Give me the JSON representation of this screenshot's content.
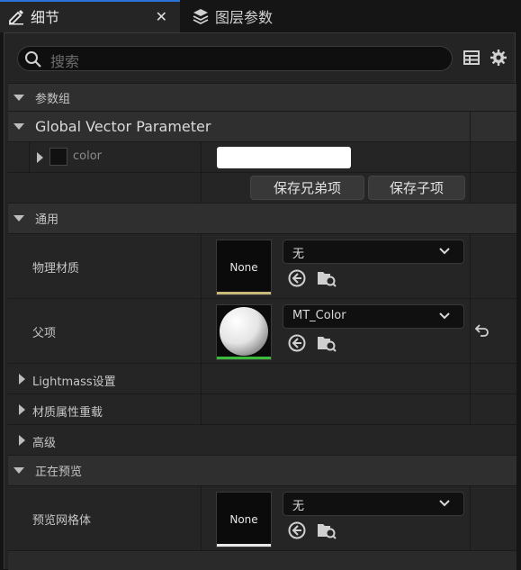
{
  "tabs": [
    {
      "label": "细节",
      "icon": "pencil-icon",
      "active": true
    },
    {
      "label": "图层参数",
      "icon": "layers-icon",
      "active": false
    }
  ],
  "search": {
    "placeholder": "搜索"
  },
  "sections": {
    "param_group": "参数组",
    "global_vector": "Global Vector Parameter",
    "general": "通用",
    "lightmass": "Lightmass设置",
    "material_override": "材质属性重载",
    "advanced": "高级",
    "previewing": "正在预览"
  },
  "color_param": {
    "label": "color",
    "swatch_color": "#111111",
    "value_color": "#ffffff"
  },
  "buttons": {
    "save_sibling": "保存兄弟项",
    "save_child": "保存子项"
  },
  "phys_material": {
    "label": "物理材质",
    "thumb_text": "None",
    "dropdown_value": "无",
    "bar_color": "#c8b87a"
  },
  "parent": {
    "label": "父项",
    "dropdown_value": "MT_Color",
    "bar_color": "#3dbb3d"
  },
  "preview_mesh": {
    "label": "预览网格体",
    "thumb_text": "None",
    "dropdown_value": "无",
    "bar_color": "#e8e8e8"
  },
  "colors": {
    "accent": "#2b72d8",
    "panel_bg": "#242424",
    "section_bg": "#2f2f2f"
  }
}
